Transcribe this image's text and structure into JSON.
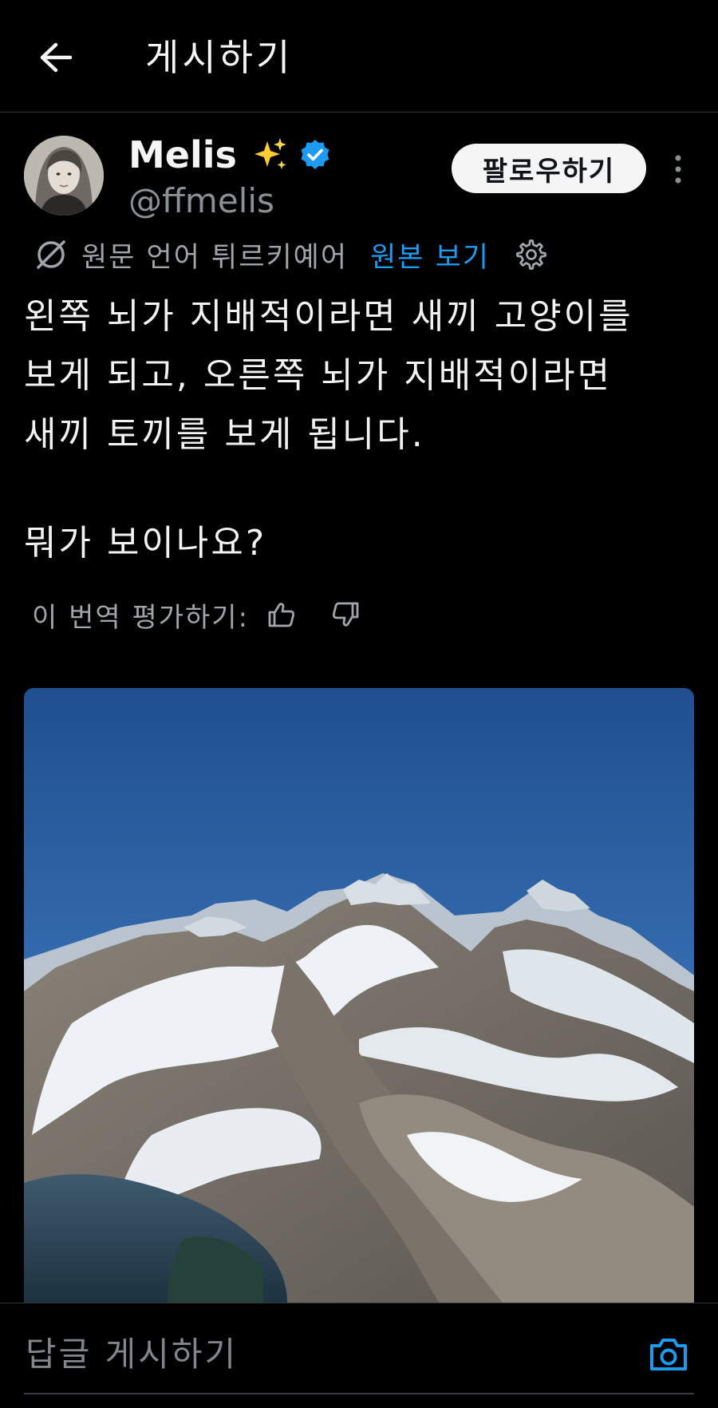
{
  "header": {
    "back_icon": "arrow-left-icon",
    "title": "게시하기"
  },
  "author": {
    "display_name": "Melis",
    "name_emoji": "sparkles-icon",
    "verified_icon": "verified-badge-icon",
    "handle": "@ffmelis",
    "follow_label": "팔로우하기",
    "more_icon": "more-vertical-icon"
  },
  "translation": {
    "icon": "translate-icon",
    "label": "원문 언어 튀르키예어",
    "show_original": "원본 보기",
    "settings_icon": "gear-icon"
  },
  "post": {
    "lines": [
      "왼쪽 뇌가 지배적이라면 새끼 고양이를",
      "보게 되고, 오른쪽 뇌가 지배적이라면",
      "새끼 토끼를 보게 됩니다."
    ],
    "question": "뭐가 보이나요?"
  },
  "rate": {
    "label": "이 번역 평가하기:",
    "thumb_up_icon": "thumbs-up-icon",
    "thumb_down_icon": "thumbs-down-icon"
  },
  "image": {
    "subject": "snowy mountain range under blue sky"
  },
  "reply": {
    "placeholder": "답글 게시하기",
    "camera_icon": "camera-icon"
  },
  "colors": {
    "background": "#000000",
    "accent": "#1d9bf0",
    "text": "#e7e9ea",
    "muted": "#8b9095"
  }
}
